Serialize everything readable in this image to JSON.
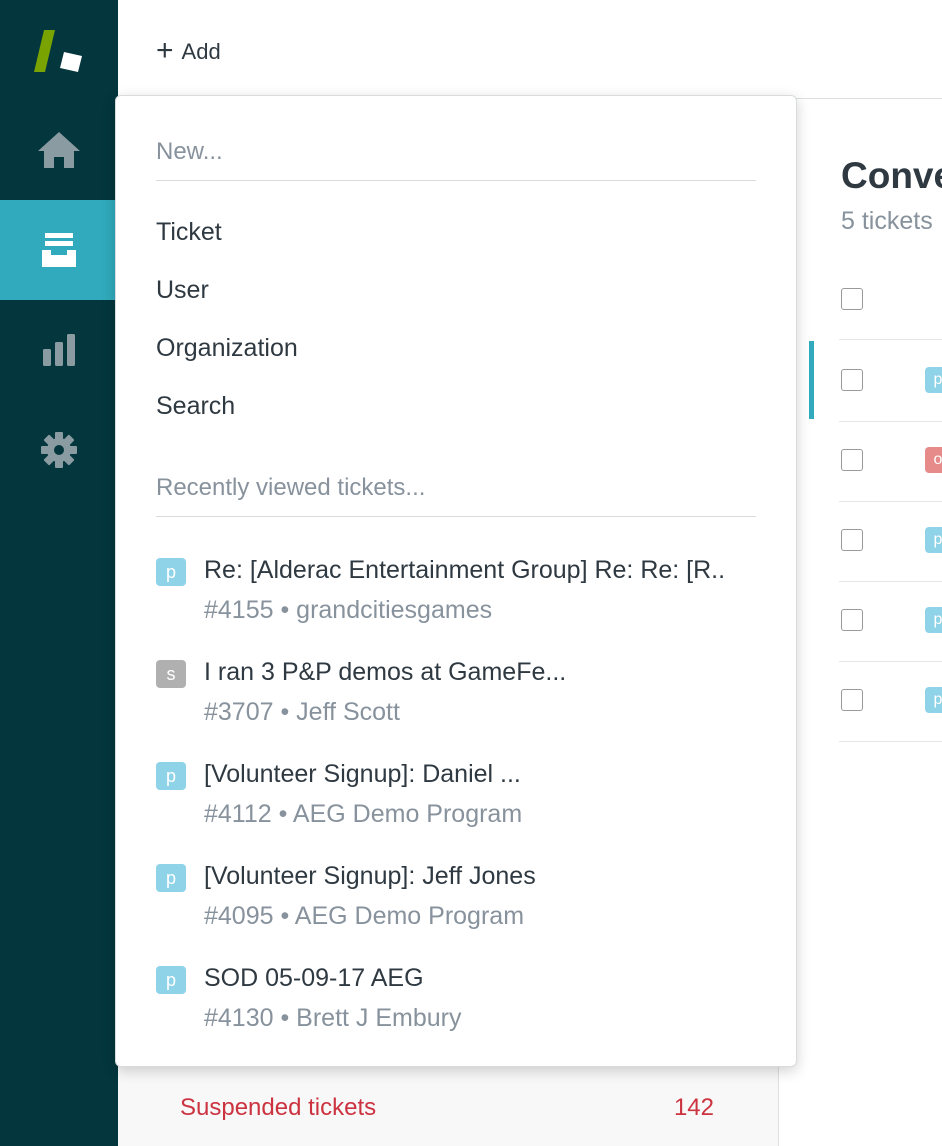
{
  "colors": {
    "sidebar_bg": "#03363d",
    "sidebar_active": "#30aabc",
    "badge_pending": "#8fd3e8",
    "badge_solved": "#b0b0b0",
    "badge_open": "#e68a8a",
    "suspended_red": "#cc3340"
  },
  "sidebar": {
    "items": [
      {
        "icon": "home-icon",
        "active": false
      },
      {
        "icon": "views-icon",
        "active": true
      },
      {
        "icon": "reporting-icon",
        "active": false
      },
      {
        "icon": "admin-gear-icon",
        "active": false
      }
    ]
  },
  "topbar": {
    "add_icon": "+",
    "add_label": "Add"
  },
  "dropdown": {
    "new_heading": "New...",
    "new_items": [
      "Ticket",
      "User",
      "Organization",
      "Search"
    ],
    "recent_heading": "Recently viewed tickets...",
    "recent": [
      {
        "badge": "p",
        "status": "pending",
        "title": "Re: [Alderac Entertainment Group] Re: Re: [R..",
        "meta": "#4155 • grandcitiesgames"
      },
      {
        "badge": "s",
        "status": "solved",
        "title": "I ran 3 P&P demos at GameFe...",
        "meta": "#3707 • Jeff Scott"
      },
      {
        "badge": "p",
        "status": "pending",
        "title": "[Volunteer Signup]: Daniel ...",
        "meta": "#4112 • AEG Demo Program"
      },
      {
        "badge": "p",
        "status": "pending",
        "title": "[Volunteer Signup]: Jeff Jones",
        "meta": "#4095 • AEG Demo Program"
      },
      {
        "badge": "p",
        "status": "pending",
        "title": "SOD 05-09-17 AEG",
        "meta": "#4130 • Brett J Embury"
      }
    ]
  },
  "views_panel": {
    "suspended_label": "Suspended tickets",
    "suspended_count": "142"
  },
  "main": {
    "title": "Conve",
    "subtitle": "5 tickets",
    "rows": [
      {
        "badge": "p",
        "status": "pending"
      },
      {
        "badge": "o",
        "status": "open"
      },
      {
        "badge": "p",
        "status": "pending"
      },
      {
        "badge": "p",
        "status": "pending"
      },
      {
        "badge": "p",
        "status": "pending"
      }
    ]
  }
}
